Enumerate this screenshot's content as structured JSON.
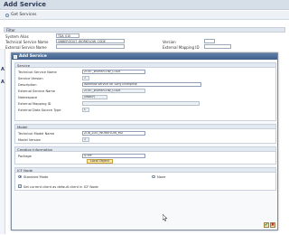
{
  "page": {
    "title": "Add Service",
    "toolbar_get_services": "Get Services",
    "filter_label": "Filter",
    "fields": {
      "system_alias_label": "System Alias",
      "system_alias_value": "TDA_010",
      "technical_service_name_label": "Technical Service Name",
      "technical_service_name_value": "/IWBEP/ZOUT_WORKFLOW_CODE",
      "external_service_name_label": "External Service Name",
      "version_label": "Version",
      "external_mapping_id_label": "External Mapping ID"
    },
    "left_edge_letters": [
      "A",
      "A"
    ]
  },
  "dialog": {
    "title": "Add Service",
    "service_section": {
      "heading": "Service",
      "technical_service_name_label": "Technical Service Name",
      "technical_service_name_value": "ZOUT_WORKFLOW_CODE",
      "service_version_label": "Service Version",
      "service_version_value": "1",
      "description_label": "Description",
      "description_value": "Workflow service for Sony Enterprise",
      "external_service_name_label": "External Service Name",
      "external_service_name_value": "ZOUT_WORKFLOW_CODE",
      "namespace_label": "Namespace",
      "namespace_value": "/IWBEP/",
      "external_mapping_id_label": "External Mapping ID",
      "external_mapping_id_value": "",
      "external_data_source_type_label": "External Data Source Type",
      "external_data_source_type_value": "C"
    },
    "model_section": {
      "heading": "Model",
      "technical_model_name_label": "Technical Model Name",
      "technical_model_name_value": "ZOB_ZOU_WORKFLOW_MD",
      "model_version_label": "Model Version",
      "model_version_value": "1"
    },
    "creation_section": {
      "heading": "Creation Information",
      "package_label": "Package",
      "package_value": "$TMP",
      "local_object_button": "Local Object"
    },
    "icf_section": {
      "heading": "ICF Node",
      "standard_mode_label": "Standard Mode",
      "none_label": "None",
      "set_default_label": "Set current client as default client in ICF Node",
      "standard_mode_selected": true,
      "set_default_checked": true
    },
    "footer": {
      "ok_symbol": "✔",
      "cancel_symbol": "✖"
    }
  }
}
